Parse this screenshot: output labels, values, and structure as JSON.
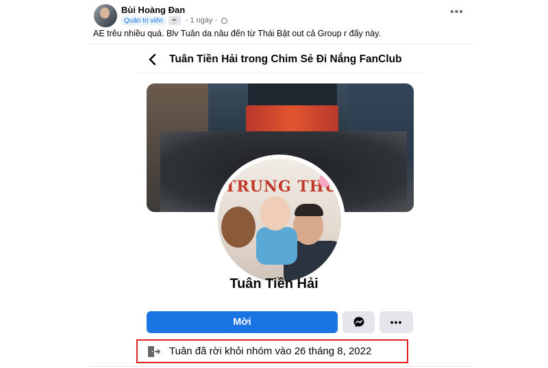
{
  "post": {
    "author": "Bùi Hoàng Đan",
    "role_badge": "Quản trị viên",
    "time": "1 ngày",
    "text": "AE trêu nhiều quá. Blv Tuân da nâu đến từ Thái Bật out cả Group r đấy này.",
    "more_label": "•••"
  },
  "shared_profile": {
    "group_title": "Tuân Tiền Hải trong Chim Sẻ Đi Nắng FanClub",
    "profile_picture_text": "TRUNG THU",
    "name": "Tuân Tiền Hải",
    "invite_label": "Mời",
    "more_label": "•••",
    "leave_notice": "Tuân đã rời khỏi nhóm vào 26 tháng 8, 2022"
  },
  "icons": {
    "back": "chevron-left-icon",
    "messenger": "messenger-icon",
    "leave": "exit-door-icon",
    "globe": "globe-icon"
  },
  "colors": {
    "primary_button": "#1b74e4",
    "secondary_button": "#e4e6eb",
    "highlight_box": "#e02020"
  }
}
